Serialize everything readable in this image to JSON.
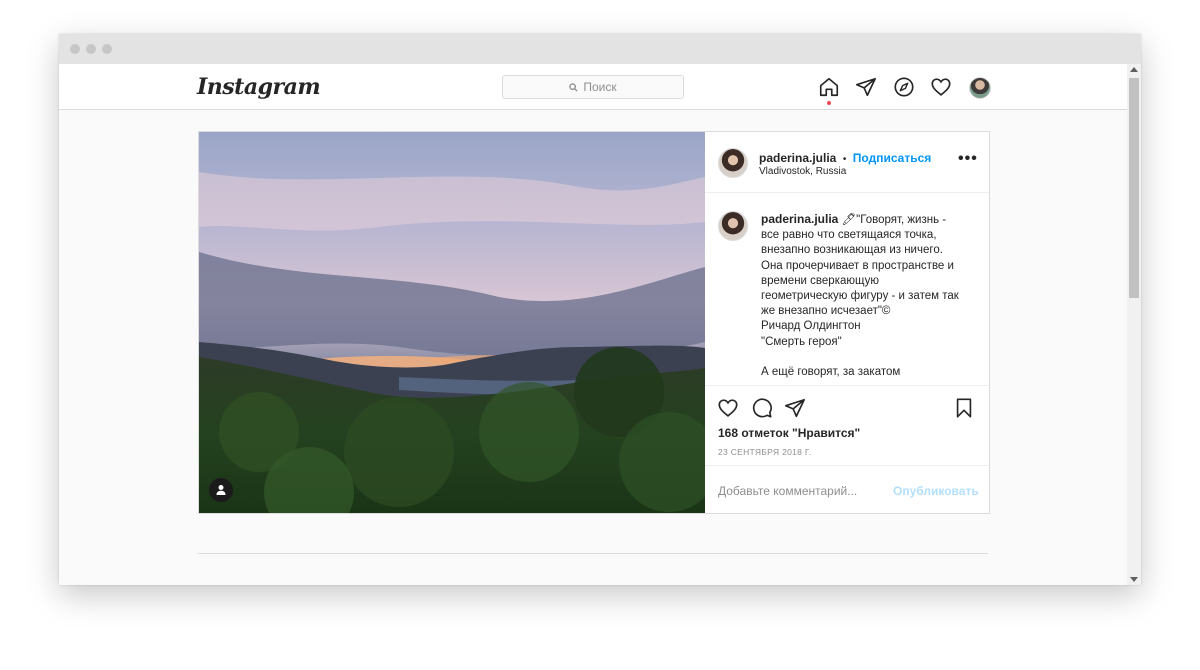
{
  "app": {
    "logo_text": "Instagram"
  },
  "search": {
    "placeholder": "Поиск"
  },
  "nav": {
    "icons": [
      "home-icon",
      "direct-icon",
      "explore-icon",
      "activity-icon",
      "profile-avatar"
    ],
    "active_color": "#ed4956"
  },
  "post": {
    "author": "paderina.julia",
    "separator": "•",
    "follow_label": "Подписаться",
    "location": "Vladivostok, Russia",
    "more_label": "•••",
    "caption": {
      "author": "paderina.julia",
      "emoji": "🖊",
      "lines": [
        "\"Говорят, жизнь - все равно что светящаяся точка, внезапно возникающая из ничего. Она прочерчивает в пространстве и времени сверкающую геометрическую фигуру - и затем так же внезапно исчезает\"©",
        "Ричард Олдингтон",
        "\"Смерть героя\"",
        "А ещё говорят, за закатом"
      ]
    },
    "likes_text": "168 отметок \"Нравится\"",
    "date": "23 СЕНТЯБРЯ 2018 Г.",
    "comment_placeholder": "Добавьте комментарий...",
    "publish_label": "Опубликовать"
  },
  "colors": {
    "link": "#0095f6",
    "publish_disabled": "#b2dffc",
    "border": "#dbdbdb"
  }
}
